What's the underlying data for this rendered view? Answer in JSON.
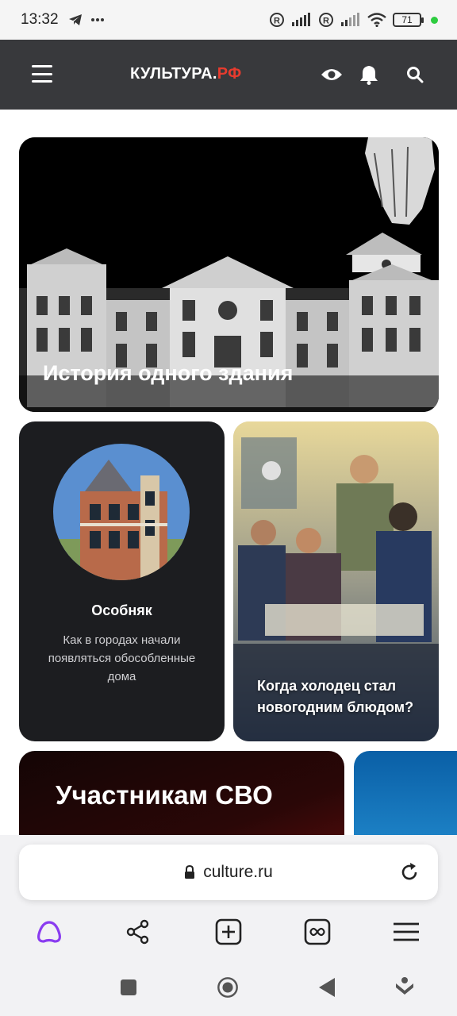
{
  "status_bar": {
    "time": "13:32",
    "battery": "71",
    "icons": [
      "telegram-icon",
      "more-dots-icon",
      "registered-icon",
      "signal-icon",
      "registered-icon",
      "signal-icon",
      "wifi-icon",
      "battery-icon"
    ]
  },
  "header": {
    "logo_main": "КУЛЬТУРА.",
    "logo_accent": "РФ",
    "icons": [
      "menu-icon",
      "eye-icon",
      "bell-icon",
      "search-icon"
    ],
    "accent_color": "#e63b2e"
  },
  "cards": {
    "hero": {
      "title": "История одного здания"
    },
    "mansion": {
      "title": "Особняк",
      "description": "Как в городах начали появляться обособленные дома"
    },
    "holodets": {
      "title": "Когда холодец стал новогодним блюдом?"
    },
    "svo": {
      "title": "Участникам СВО"
    }
  },
  "browser": {
    "url": "culture.ru",
    "toolbar_icons": [
      "alice-icon",
      "share-icon",
      "new-tab-icon",
      "tabs-icon",
      "menu-icon"
    ],
    "alice_color": "#8a3cf0"
  },
  "nav": {
    "icons": [
      "recents-square-icon",
      "home-circle-icon",
      "back-triangle-icon",
      "assistant-icon"
    ]
  }
}
